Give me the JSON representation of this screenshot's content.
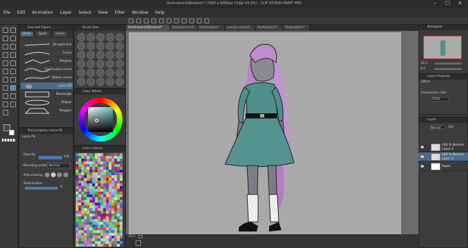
{
  "titlebar": {
    "title": "Illustration2(Restore)* (7000 x 5000px 72dpi 33.3%) - CLIP STUDIO PAINT PRO"
  },
  "menu": [
    "File",
    "Edit",
    "Animation",
    "Layer",
    "Select",
    "View",
    "Filter",
    "Window",
    "Help"
  ],
  "window_controls": {
    "minimize": "–",
    "maximize": "☐",
    "close": "✕"
  },
  "subtool": {
    "title": "Sub tool Figure",
    "tabs": [
      "Direc",
      "Speci",
      "Focus"
    ],
    "items": [
      "Straight line",
      "Curve",
      "Polyline",
      "Continuous curve",
      "Bezier curve",
      "Lasso fill",
      "Rectangle",
      "Ellipse",
      "Polygon"
    ]
  },
  "brush_size": {
    "title": "Brush Size"
  },
  "color_wheel": {
    "title": "Color Wheel",
    "hue_color": "#6ec4c8"
  },
  "tool_property": {
    "title": "Tool property Lasso fill",
    "subtitle": "Lasso fill",
    "opacity_label": "Opacity",
    "opacity_value": "100",
    "blending_label": "Blending mode",
    "blending_value": "Normal",
    "antialias_label": "Anti-aliasing",
    "stabilization_label": "Stabilization",
    "stabilization_value": "6"
  },
  "color_history": {
    "title": "Color History"
  },
  "tabs": [
    "Illustration2(Restore)*",
    "Illustration1(S...",
    "Illustration1*",
    "marah comm2...",
    "Illustration1*",
    "Illustration1*"
  ],
  "status": {
    "zoom": "33.3"
  },
  "navigator": {
    "title": "Navigator",
    "zoom": "33.3",
    "angle": "0.0"
  },
  "layer_property": {
    "title": "Layer Property",
    "effect": "Effect",
    "expression_label": "Expression color",
    "expression_value": "Color"
  },
  "layer_panel": {
    "title": "Layer",
    "blend": "Normal",
    "opacity": "100",
    "layers": [
      {
        "name": "100 % Normal\nLayer 1"
      },
      {
        "name": "100 % Normal\nLayer 2"
      },
      {
        "name": "Paper"
      }
    ]
  }
}
